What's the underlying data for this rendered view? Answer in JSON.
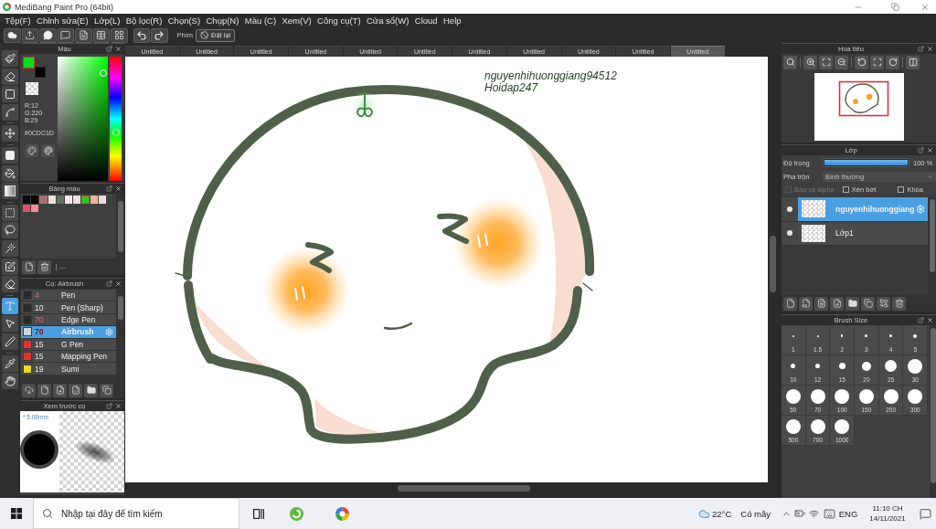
{
  "window": {
    "title": "MediBang Paint Pro (64bit)"
  },
  "menu": [
    "Tệp(F)",
    "Chỉnh sửa(E)",
    "Lớp(L)",
    "Bộ lọc(R)",
    "Chọn(S)",
    "Chụp(N)",
    "Màu (C)",
    "Xem(V)",
    "Công cụ(T)",
    "Cửa sổ(W)",
    "Cloud",
    "Help"
  ],
  "toolbar": {
    "shortcut_label": "Phím",
    "reset_button": "Đặt lại"
  },
  "tools": [
    {
      "selected": false
    },
    {
      "selected": false
    },
    {
      "selected": false
    },
    {
      "selected": false
    },
    {
      "selected": false
    },
    {
      "selected": false
    },
    {
      "selected": false
    },
    {
      "selected": false
    },
    {
      "selected": false
    },
    {
      "selected": false
    },
    {
      "selected": false
    },
    {
      "selected": false
    },
    {
      "selected": false
    },
    {
      "selected": true
    },
    {
      "selected": false
    },
    {
      "selected": false
    },
    {
      "selected": false
    },
    {
      "selected": false
    }
  ],
  "color_panel": {
    "title": "Màu",
    "swatches": [
      {
        "kind": "primary",
        "color": "#0cdc1d"
      },
      {
        "kind": "secondary",
        "color": "#000000"
      }
    ],
    "hue": {
      "level": 0.38
    },
    "readings": [
      "R:12",
      "G:220",
      "B:29"
    ],
    "hex": "#0CDC1D"
  },
  "palette_panel": {
    "title": "Bảng màu",
    "swatches": [
      {
        "color": "#0b0b18",
        "selected": false
      },
      {
        "color": "#050505",
        "selected": false
      },
      {
        "color": "#a87070",
        "selected": false
      },
      {
        "color": "#f5e0d5",
        "selected": false
      },
      {
        "color": "#627060",
        "selected": false
      },
      {
        "color": "#f8e8e8",
        "selected": false
      },
      {
        "color": "#f0dde3",
        "selected": false
      },
      {
        "color": "#0cdc1d",
        "selected": true
      },
      {
        "color": "#f7b0a0",
        "selected": false
      },
      {
        "color": "#eedde5",
        "selected": false
      },
      {
        "color": "#e05068",
        "selected": false
      },
      {
        "color": "#f08c94",
        "selected": false
      }
    ],
    "footer": "---"
  },
  "brush_panel": {
    "title": "Cọ: Airbrush",
    "brushes": [
      {
        "size": "4",
        "size_highlighted": true,
        "name": "Pen",
        "color": "#2a2a2a",
        "selected": false
      },
      {
        "size": "10",
        "size_highlighted": false,
        "name": "Pen (Sharp)",
        "color": "#2a2a2a",
        "selected": false
      },
      {
        "size": "70",
        "size_highlighted": true,
        "name": "Edge Pen",
        "color": "#2a2a2a",
        "selected": false
      },
      {
        "size": "70",
        "size_highlighted": true,
        "name": "Airbrush",
        "color": "#d4d4d4",
        "selected": true
      },
      {
        "size": "15",
        "size_highlighted": false,
        "name": "G Pen",
        "color": "#e83232",
        "selected": false
      },
      {
        "size": "15",
        "size_highlighted": false,
        "name": "Mapping Pen",
        "color": "#e83232",
        "selected": false
      },
      {
        "size": "19",
        "size_highlighted": false,
        "name": "Sumi",
        "color": "#e8d820",
        "selected": false
      }
    ]
  },
  "brush_preview": {
    "title": "Xem trước cọ",
    "size": "* 5.08mm"
  },
  "tabs": [
    {
      "label": "Untitled",
      "selected": false
    },
    {
      "label": "Untitled",
      "selected": false
    },
    {
      "label": "Untitled",
      "selected": false
    },
    {
      "label": "Untitled",
      "selected": false
    },
    {
      "label": "Untitled",
      "selected": false
    },
    {
      "label": "Untitled",
      "selected": false
    },
    {
      "label": "Untitled",
      "selected": false
    },
    {
      "label": "Untitled",
      "selected": false
    },
    {
      "label": "Untitled",
      "selected": false
    },
    {
      "label": "Untitled",
      "selected": false
    },
    {
      "label": "Untitled",
      "selected": true
    }
  ],
  "canvas": {
    "texts": [
      "nguyenhihuonggiang94512",
      "Hoidap247"
    ]
  },
  "navigator": {
    "title": "Hoa tiêu"
  },
  "layer_panel": {
    "title": "Lớp",
    "opacity_label": "Độ trong",
    "opacity": {
      "level": 1,
      "reading": "100 %"
    },
    "blend_label": "Pha trộn",
    "blend_mode": "Bình thường",
    "options": [
      {
        "label": "Bảo vệ alpha",
        "checked": false,
        "disabled": true
      },
      {
        "label": "Xén bớt",
        "checked": false,
        "disabled": false
      },
      {
        "label": "Khóa",
        "checked": false,
        "disabled": false
      }
    ],
    "layers": [
      {
        "name": "nguyenhihuonggiang",
        "visible": true,
        "selected": true
      },
      {
        "name": "Lớp1",
        "visible": true,
        "selected": false
      }
    ]
  },
  "brush_size_panel": {
    "title": "Brush Size",
    "sizes": [
      "1",
      "1.5",
      "2",
      "3",
      "4",
      "5",
      "10",
      "12",
      "15",
      "20",
      "25",
      "30",
      "50",
      "70",
      "100",
      "150",
      "200",
      "300",
      "500",
      "700",
      "1000"
    ]
  },
  "taskbar": {
    "search": {
      "placeholder": "Nhập tại đây để tìm kiếm"
    },
    "weather": {
      "temperature": "22°C",
      "condition": "Có mây"
    },
    "language": "ENG",
    "time": "11:10 CH",
    "date": "14/11/2021"
  }
}
